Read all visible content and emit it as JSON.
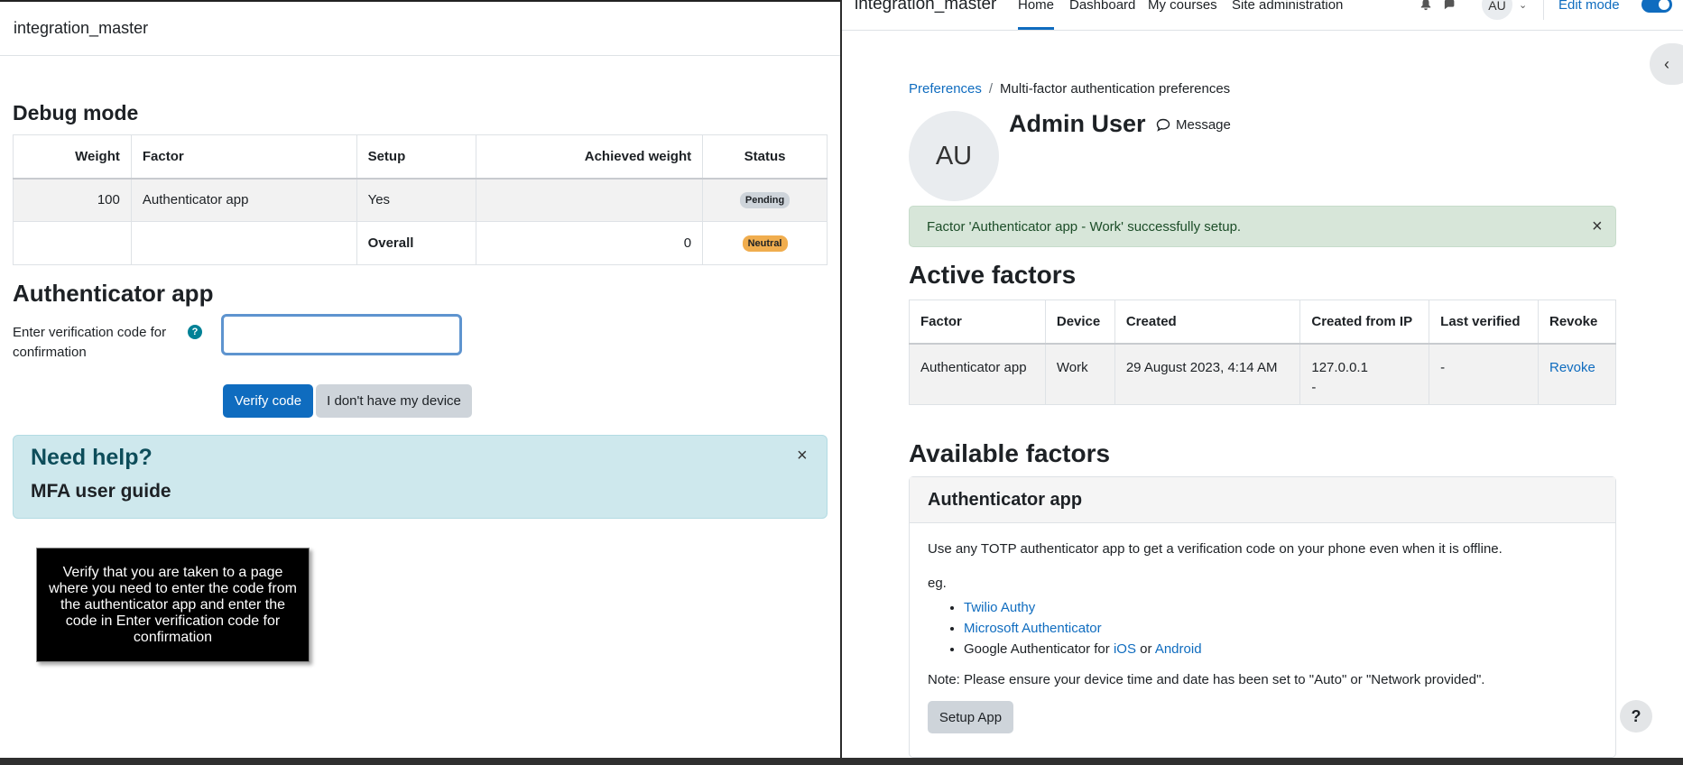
{
  "left": {
    "header_title": "integration_master",
    "debug_heading": "Debug mode",
    "debug_table": {
      "headers": [
        "Weight",
        "Factor",
        "Setup",
        "Achieved weight",
        "Status"
      ],
      "row1": {
        "weight": "100",
        "factor": "Authenticator app",
        "setup": "Yes",
        "achieved": "",
        "status": "Pending"
      },
      "overall": {
        "label": "Overall",
        "achieved": "0",
        "status": "Neutral"
      }
    },
    "auth_heading": "Authenticator app",
    "code_label": "Enter verification code for confirmation",
    "help_icon": "?",
    "code_value": "",
    "verify_button": "Verify code",
    "no_device_button": "I don't have my device",
    "help_alert": {
      "title": "Need help?",
      "link": "MFA user guide",
      "close": "×"
    },
    "instruction": "Verify that you are taken to a page where you need to enter the code from the authenticator app and enter the code in Enter verification code for confirmation"
  },
  "right": {
    "brand": "integration_master",
    "nav": [
      "Home",
      "Dashboard",
      "My courses",
      "Site administration"
    ],
    "bell_icon": "bell-icon",
    "chat_icon": "chat-icon",
    "user_initials": "AU",
    "edit_mode": "Edit mode",
    "breadcrumb": {
      "parent": "Preferences",
      "sep": "/",
      "current": "Multi-factor authentication preferences"
    },
    "avatar_initials": "AU",
    "user_name": "Admin User",
    "message_label": "Message",
    "success_alert": "Factor 'Authenticator app - Work' successfully setup.",
    "success_close": "×",
    "active_heading": "Active factors",
    "active_table": {
      "headers": [
        "Factor",
        "Device",
        "Created",
        "Created from IP",
        "Last verified",
        "Revoke"
      ],
      "row": {
        "factor": "Authenticator app",
        "device": "Work",
        "created": "29 August 2023, 4:14 AM",
        "ip": "127.0.0.1",
        "ip_sub": "-",
        "last_verified": "-",
        "revoke": "Revoke"
      }
    },
    "available_heading": "Available factors",
    "card": {
      "title": "Authenticator app",
      "description": "Use any TOTP authenticator app to get a verification code on your phone even when it is offline.",
      "eg": "eg.",
      "apps": {
        "twilio": "Twilio Authy",
        "microsoft": "Microsoft Authenticator",
        "google_prefix": "Google Authenticator for",
        "ios": "iOS",
        "or": "or",
        "android": "Android"
      },
      "note": "Note: Please ensure your device time and date has been set to \"Auto\" or \"Network provided\".",
      "setup_button": "Setup App"
    },
    "help_button": "?"
  },
  "colors": {
    "primary": "#0f6cbf",
    "success_bg": "#d7e6d9",
    "info_bg": "#cee8ed",
    "pending_badge": "#ced4da",
    "neutral_badge": "#f0ad4e"
  }
}
